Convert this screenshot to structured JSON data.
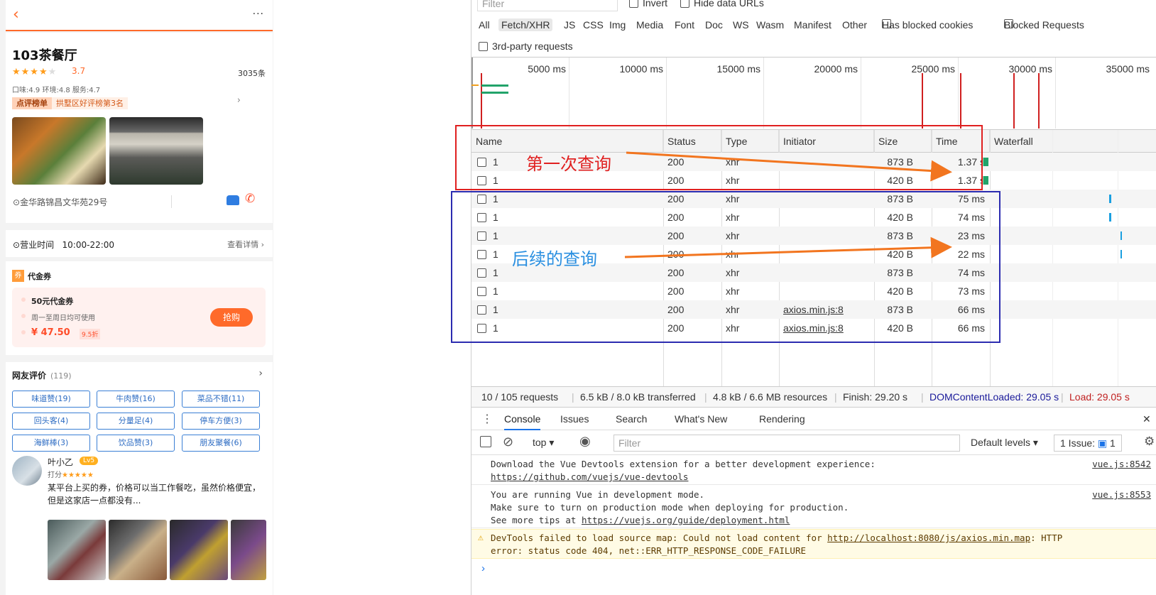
{
  "mobile": {
    "header": {
      "back_icon": "‹",
      "more_icon": "···"
    },
    "shop": {
      "name": "103茶餐厅",
      "rating": "3.7",
      "review_count": "3035条",
      "subscores": "口味:4.9 环境:4.8 服务:4.7",
      "rank_badge": "点评榜单",
      "rank_text": "拱墅区好评榜第3名"
    },
    "address": "金华路锦昌文华苑29号",
    "hours": {
      "label": "营业时间",
      "value": "10:00-22:00",
      "detail": "查看详情"
    },
    "voucher": {
      "section_tag": "券",
      "section_title": "代金券",
      "name": "50元代金券",
      "desc": "周一至周日均可使用",
      "price": "¥ 47.50",
      "discount": "9.5折",
      "buy_label": "抢购"
    },
    "reviews": {
      "title": "网友评价",
      "count": "(119)",
      "tags": [
        "味道赞(19)",
        "牛肉赞(16)",
        "菜品不错(11)",
        "回头客(4)",
        "分量足(4)",
        "停车方便(3)",
        "海鲜棒(3)",
        "饮品赞(3)",
        "朋友聚餐(6)"
      ],
      "user": "叶小乙",
      "level": "Lv5",
      "score_label": "打分",
      "text": "某平台上买的券，价格可以当工作餐吃，虽然价格便宜，但是这家店一点都没有..."
    }
  },
  "devtools": {
    "filter_placeholder": "Filter",
    "invert_label": "Invert",
    "hide_data_label": "Hide data URLs",
    "types": [
      "All",
      "Fetch/XHR",
      "JS",
      "CSS",
      "Img",
      "Media",
      "Font",
      "Doc",
      "WS",
      "Wasm",
      "Manifest",
      "Other"
    ],
    "has_blocked_cookies": "Has blocked cookies",
    "blocked_requests": "Blocked Requests",
    "third_party": "3rd-party requests",
    "timeline_ticks": [
      "5000 ms",
      "10000 ms",
      "15000 ms",
      "20000 ms",
      "25000 ms",
      "30000 ms",
      "35000 ms"
    ],
    "columns": [
      "Name",
      "Status",
      "Type",
      "Initiator",
      "Size",
      "Time",
      "Waterfall"
    ],
    "rows": [
      {
        "name": "1",
        "status": "200",
        "type": "xhr",
        "initiator": "",
        "size": "873 B",
        "time": "1.37 s"
      },
      {
        "name": "1",
        "status": "200",
        "type": "xhr",
        "initiator": "",
        "size": "420 B",
        "time": "1.37 s"
      },
      {
        "name": "1",
        "status": "200",
        "type": "xhr",
        "initiator": "",
        "size": "873 B",
        "time": "75 ms"
      },
      {
        "name": "1",
        "status": "200",
        "type": "xhr",
        "initiator": "",
        "size": "420 B",
        "time": "74 ms"
      },
      {
        "name": "1",
        "status": "200",
        "type": "xhr",
        "initiator": "",
        "size": "873 B",
        "time": "23 ms"
      },
      {
        "name": "1",
        "status": "200",
        "type": "xhr",
        "initiator": "",
        "size": "420 B",
        "time": "22 ms"
      },
      {
        "name": "1",
        "status": "200",
        "type": "xhr",
        "initiator": "",
        "size": "873 B",
        "time": "74 ms"
      },
      {
        "name": "1",
        "status": "200",
        "type": "xhr",
        "initiator": "",
        "size": "420 B",
        "time": "73 ms"
      },
      {
        "name": "1",
        "status": "200",
        "type": "xhr",
        "initiator": "axios.min.js:8",
        "size": "873 B",
        "time": "66 ms"
      },
      {
        "name": "1",
        "status": "200",
        "type": "xhr",
        "initiator": "axios.min.js:8",
        "size": "420 B",
        "time": "66 ms"
      }
    ],
    "summary": {
      "requests": "10 / 105 requests",
      "transferred": "6.5 kB / 8.0 kB transferred",
      "resources": "4.8 kB / 6.6 MB resources",
      "finish": "Finish: 29.20 s",
      "dcl": "DOMContentLoaded: 29.05 s",
      "load": "Load: 29.05 s"
    },
    "console_tabs": [
      "Console",
      "Issues",
      "Search",
      "What's New",
      "Rendering"
    ],
    "console_toolbar": {
      "context": "top",
      "filter_placeholder": "Filter",
      "levels": "Default levels",
      "issues": "1 Issue:",
      "issue_count": "1"
    },
    "messages": {
      "m1_line1": "Download the Vue Devtools extension for a better development experience:",
      "m1_link": "https://github.com/vuejs/vue-devtools",
      "m1_src": "vue.js:8542",
      "m2_line1": "You are running Vue in development mode.",
      "m2_line2": "Make sure to turn on production mode when deploying for production.",
      "m2_line3_pre": "See more tips at ",
      "m2_link": "https://vuejs.org/guide/deployment.html",
      "m2_src": "vue.js:8553",
      "m3_pre": "DevTools failed to load source map: Could not load content for ",
      "m3_link": "http://localhost:8080/js/axios.min.map",
      "m3_post": ": HTTP",
      "m3_line2": "error: status code 404, net::ERR_HTTP_RESPONSE_CODE_FAILURE"
    }
  },
  "annotations": {
    "first": "第一次查询",
    "later": "后续的查询"
  },
  "colors": {
    "accent": "#ff6a2a",
    "red_box": "#e02020",
    "blue_box": "#2c2cb0",
    "arrow": "#f2751f"
  }
}
